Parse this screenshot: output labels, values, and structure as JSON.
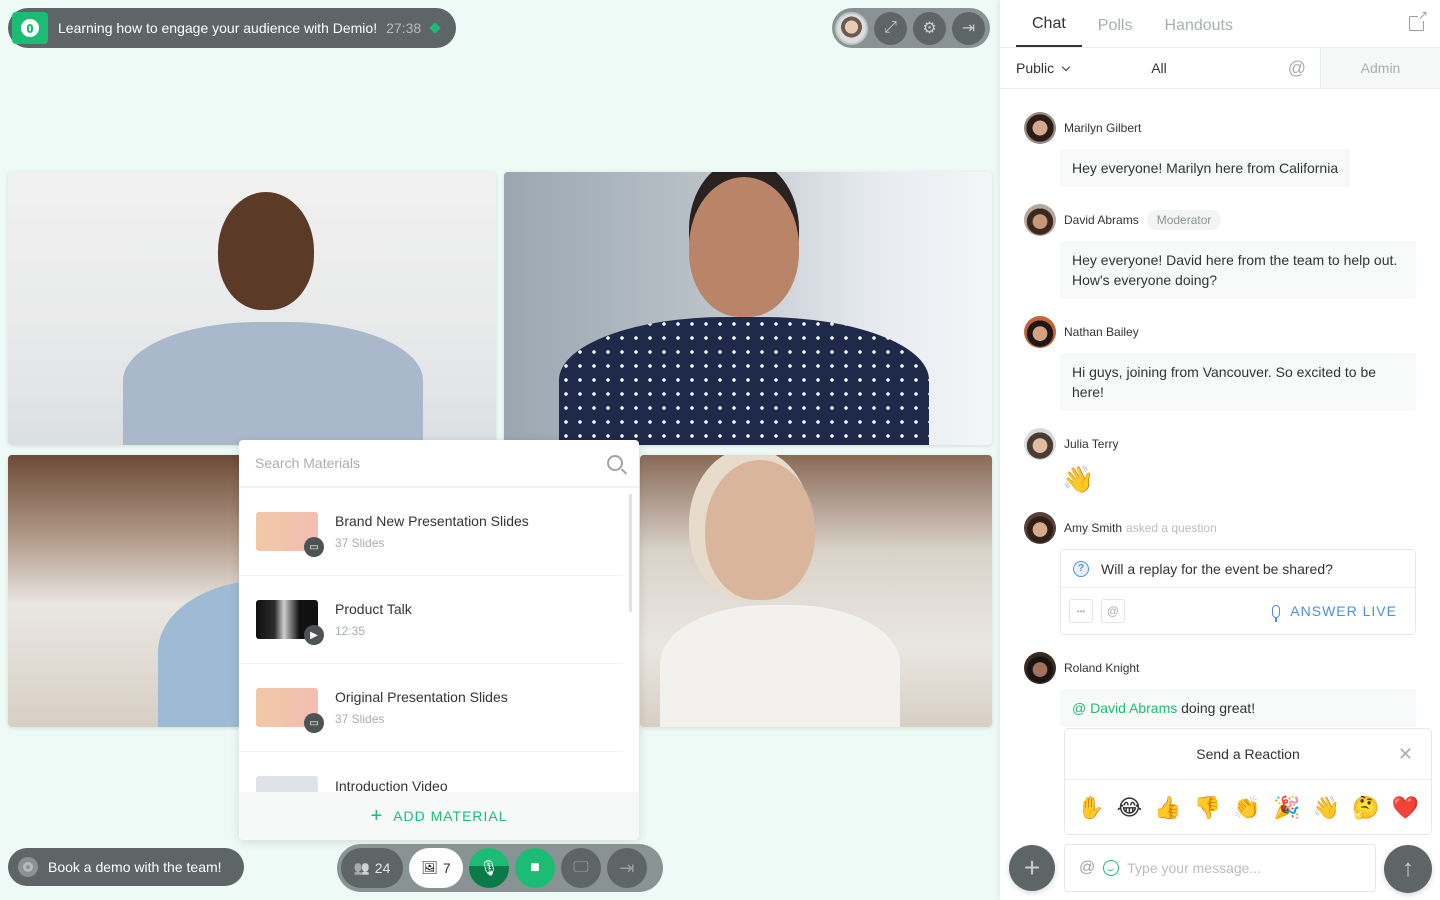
{
  "session": {
    "title": "Learning how to engage your audience with Demio!",
    "timer": "27:38",
    "live_indicator": "live-dot",
    "brand_color": "#1cbc74"
  },
  "top_controls": {
    "items": [
      {
        "icon": "self-avatar",
        "label": "Your camera preview"
      },
      {
        "icon": "expand-icon",
        "glyph": "⤢"
      },
      {
        "icon": "gear-icon",
        "glyph": "⚙"
      },
      {
        "icon": "exit-icon",
        "glyph": "⇥"
      }
    ]
  },
  "video_tiles": [
    {
      "participant": "Presenter 1"
    },
    {
      "participant": "Presenter 2"
    },
    {
      "participant": "Presenter 3"
    },
    {
      "participant": "Presenter 4"
    }
  ],
  "materials": {
    "search_placeholder": "Search Materials",
    "items": [
      {
        "title": "Brand New Presentation Slides",
        "subtitle": "37 Slides",
        "type": "slides",
        "badge_glyph": "▭"
      },
      {
        "title": "Product Talk",
        "subtitle": "12:35",
        "type": "video",
        "badge_glyph": "▶"
      },
      {
        "title": "Original Presentation Slides",
        "subtitle": "37 Slides",
        "type": "slides",
        "badge_glyph": "▭"
      },
      {
        "title": "Introduction Video",
        "subtitle": "",
        "type": "video",
        "badge_glyph": ""
      }
    ],
    "add_label": "ADD MATERIAL",
    "add_glyph": "+"
  },
  "bottom_bar": {
    "book_demo_label": "Book a demo with the team!",
    "attendees_count": "24",
    "attendees_glyph": "👥",
    "materials_count": "7",
    "materials_glyph": "🖼",
    "mic_glyph": "🎙",
    "camera_glyph": "■",
    "screen_share_glyph": "🖵",
    "leave_glyph": "⇥"
  },
  "sidebar": {
    "tabs": [
      {
        "label": "Chat",
        "active": true
      },
      {
        "label": "Polls",
        "active": false
      },
      {
        "label": "Handouts",
        "active": false
      }
    ],
    "filters": {
      "audience": "Public",
      "scope": "All",
      "mention_glyph": "@",
      "admin": "Admin"
    },
    "messages": [
      {
        "name": "Marilyn Gilbert",
        "text": "Hey everyone! Marilyn here from California"
      },
      {
        "name": "David Abrams",
        "badge": "Moderator",
        "text": "Hey everyone! David here from the team to help out. How's everyone doing?"
      },
      {
        "name": "Nathan Bailey",
        "text": "Hi guys, joining from Vancouver. So excited to be here!"
      },
      {
        "name": "Julia Terry",
        "emoji": "👋"
      },
      {
        "name": "Amy Smith",
        "meta": "asked a question",
        "question": "Will a replay for the event be shared?",
        "more_glyph": "•••",
        "mention_glyph": "@",
        "answer_label": "ANSWER LIVE"
      },
      {
        "name": "Roland Knight",
        "mention": "@ David Abrams",
        "text": " doing great!"
      }
    ],
    "reactions": {
      "title": "Send a Reaction",
      "close_glyph": "✕",
      "emojis": [
        "✋",
        "😂",
        "👍",
        "👎",
        "👏",
        "🎉",
        "👋",
        "🤔",
        "❤️"
      ]
    },
    "composer": {
      "plus_glyph": "+",
      "at_glyph": "@",
      "placeholder": "Type your message...",
      "send_glyph": "↑"
    }
  }
}
